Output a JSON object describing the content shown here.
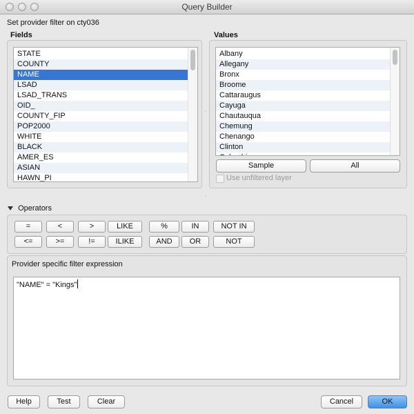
{
  "window": {
    "title": "Query Builder"
  },
  "header_text": "Set provider filter on cty036",
  "fields": {
    "label": "Fields",
    "items": [
      "STATE",
      "COUNTY",
      "NAME",
      "LSAD",
      "LSAD_TRANS",
      "OID_",
      "COUNTY_FIP",
      "POP2000",
      "WHITE",
      "BLACK",
      "AMER_ES",
      "ASIAN",
      "HAWN_PI"
    ],
    "selected": "NAME"
  },
  "values": {
    "label": "Values",
    "items": [
      "Albany",
      "Allegany",
      "Bronx",
      "Broome",
      "Cattaraugus",
      "Cayuga",
      "Chautauqua",
      "Chemung",
      "Chenango",
      "Clinton",
      "Columbia"
    ],
    "sample_label": "Sample",
    "all_label": "All",
    "use_unfiltered_label": "Use unfiltered layer"
  },
  "operators": {
    "label": "Operators",
    "row1": [
      "=",
      "<",
      ">",
      "LIKE",
      "%",
      "IN",
      "NOT IN"
    ],
    "row2": [
      "<=",
      ">=",
      "!=",
      "ILIKE",
      "AND",
      "OR",
      "NOT"
    ]
  },
  "expression": {
    "label": "Provider specific filter expression",
    "text": "\"NAME\" = \"Kings\""
  },
  "footer": {
    "help_label": "Help",
    "test_label": "Test",
    "clear_label": "Clear",
    "cancel_label": "Cancel",
    "ok_label": "OK"
  },
  "colors": {
    "selection": "#3876d6",
    "primary_button": "#3f90e6"
  }
}
